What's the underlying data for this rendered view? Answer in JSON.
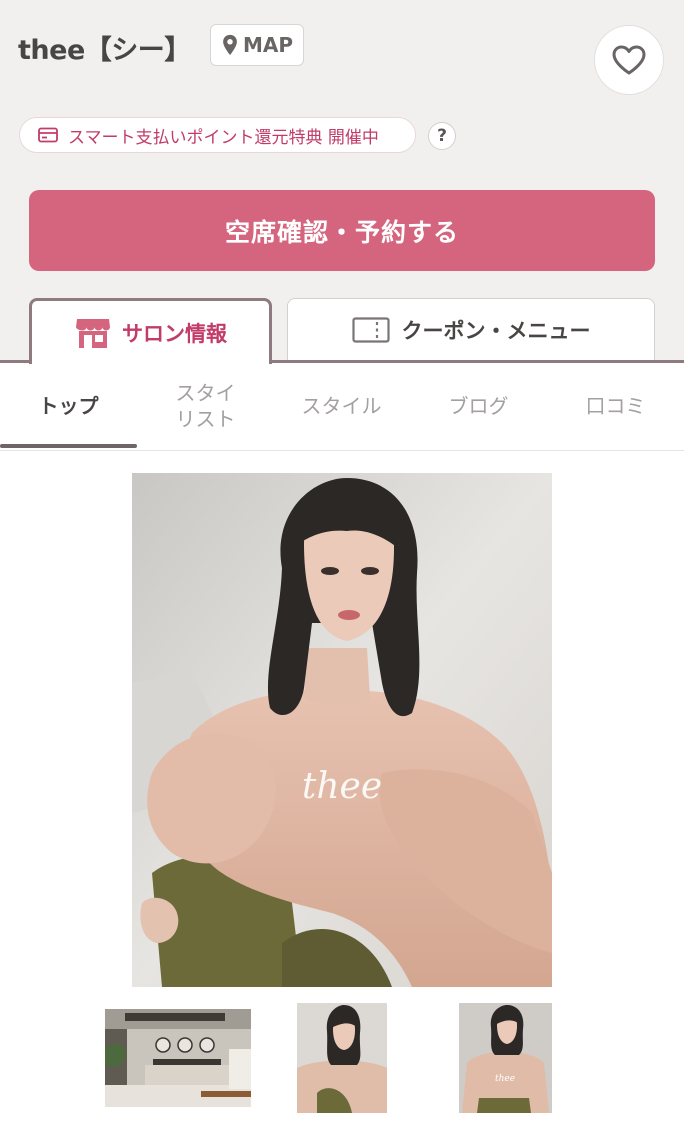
{
  "header": {
    "salon_name": "thee【シー】",
    "map_label": "MAP",
    "promo_text": "スマート支払いポイント還元特典 開催中",
    "help_label": "?"
  },
  "reserve_button": {
    "label": "空席確認・予約する"
  },
  "main_tabs": [
    {
      "label": "サロン情報",
      "icon": "salon-store-icon",
      "active": true
    },
    {
      "label": "クーポン・メニュー",
      "icon": "coupon-ticket-icon",
      "active": false
    }
  ],
  "sub_nav": [
    {
      "label": "トップ",
      "active": true
    },
    {
      "label": "スタイ\nリスト",
      "active": false
    },
    {
      "label": "スタイル",
      "active": false
    },
    {
      "label": "ブログ",
      "active": false
    },
    {
      "label": "口コミ",
      "active": false
    }
  ],
  "gallery": {
    "hero_caption": "thee",
    "thumbnails": [
      "salon-interior",
      "model-portrait-1",
      "model-portrait-2"
    ]
  },
  "colors": {
    "accent": "#d5657f",
    "accent_text": "#c23c6a",
    "tab_border": "#8f7a80",
    "background": "#f2f0ef"
  }
}
